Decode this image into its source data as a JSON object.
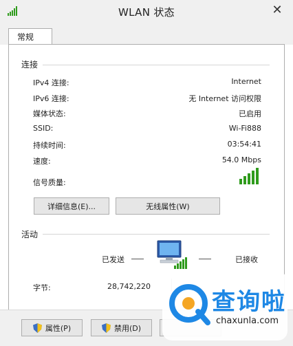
{
  "window": {
    "title": "WLAN 状态",
    "close_glyph": "✕"
  },
  "tabs": [
    {
      "label": "常规"
    }
  ],
  "connection": {
    "group_label": "连接",
    "rows": [
      {
        "label": "IPv4 连接:",
        "value": "Internet"
      },
      {
        "label": "IPv6 连接:",
        "value": "无 Internet 访问权限"
      },
      {
        "label": "媒体状态:",
        "value": "已启用"
      },
      {
        "label": "SSID:",
        "value": "Wi-Fi888"
      },
      {
        "label": "持续时间:",
        "value": "03:54:41"
      },
      {
        "label": "速度:",
        "value": "54.0 Mbps"
      }
    ],
    "signal_label": "信号质量:",
    "signal_bars": 5,
    "signal_color": "#2f9b1c"
  },
  "buttons": {
    "details": "详细信息(E)...",
    "wireless_props": "无线属性(W)"
  },
  "activity": {
    "group_label": "活动",
    "sent_label": "已发送",
    "received_label": "已接收",
    "bytes_label": "字节:",
    "bytes_sent": "28,742,220"
  },
  "bottom_buttons": {
    "properties": "属性(P)",
    "disable": "禁用(D)"
  },
  "watermark": {
    "text": "查询啦",
    "url": "chaxunla.com",
    "brand_color": "#1e88e5"
  }
}
